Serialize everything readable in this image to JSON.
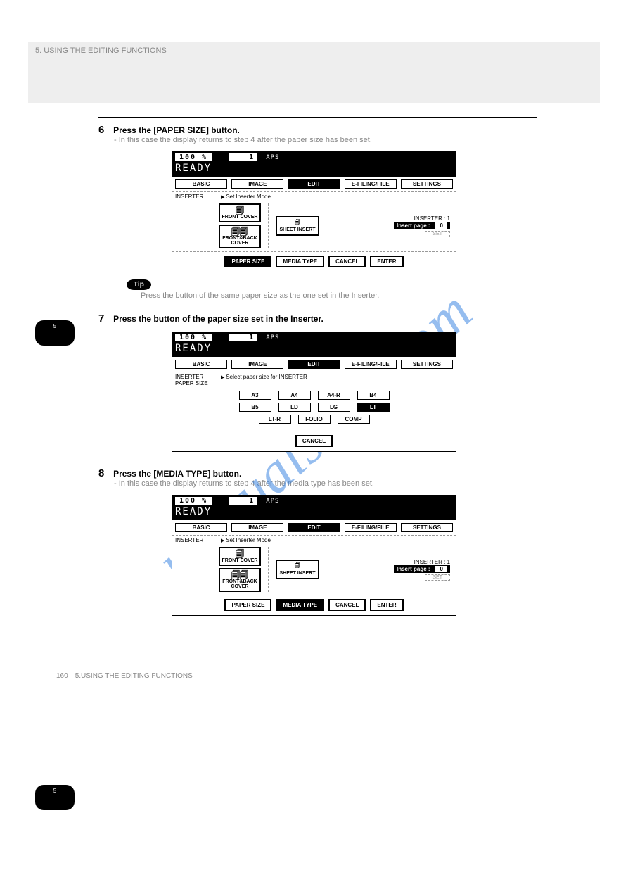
{
  "watermark": "manualslive.com",
  "greybar_text": "5. USING THE EDITING FUNCTIONS",
  "step6": {
    "num": "6",
    "text": "Press the [PAPER SIZE] button.",
    "sub": "- In this case the display returns to step 4 after the paper size has been set."
  },
  "panelA": {
    "percent": "100  %",
    "count": "1",
    "aps": "APS",
    "ready": "READY",
    "tabs": [
      "BASIC",
      "IMAGE",
      "EDIT",
      "E-FILING/FILE",
      "SETTINGS"
    ],
    "tabSel": 2,
    "leftLabel": "INSERTER",
    "hint": "Set Inserter Mode",
    "chips": [
      "FRONT COVER",
      "FRONT&BACK COVER"
    ],
    "sheetChip": "SHEET INSERT",
    "info1": "INSERTER    :    1",
    "insertLabel": "Insert page   :",
    "insertVal": "0",
    "setLabel": "SET",
    "foot": [
      "PAPER SIZE",
      "MEDIA TYPE",
      "CANCEL",
      "ENTER"
    ],
    "footSel": 0
  },
  "tip": {
    "pill": "Tip",
    "line": "Press the button of the same paper size as the one set in the Inserter."
  },
  "sideA": "5",
  "step7": {
    "num": "7",
    "text": "Press the button of the paper size set in the Inserter."
  },
  "panelB": {
    "percent": "100  %",
    "count": "1",
    "aps": "APS",
    "ready": "READY",
    "tabs": [
      "BASIC",
      "IMAGE",
      "EDIT",
      "E-FILING/FILE",
      "SETTINGS"
    ],
    "tabSel": 2,
    "leftLabel": "INSERTER",
    "leftSub": "PAPER SIZE",
    "hint": "Select paper size for INSERTER",
    "rows": [
      [
        "A3",
        "A4",
        "A4-R",
        "B4"
      ],
      [
        "B5",
        "LD",
        "LG",
        "LT"
      ],
      [
        "LT-R",
        "FOLIO",
        "COMP"
      ]
    ],
    "selRow": 1,
    "selCol": 3,
    "cancel": "CANCEL"
  },
  "step8": {
    "num": "8",
    "text": "Press the [MEDIA TYPE] button.",
    "sub": "- In this case the display returns to step 4 after the media type has been set."
  },
  "panelC": {
    "percent": "100  %",
    "count": "1",
    "aps": "APS",
    "ready": "READY",
    "tabs": [
      "BASIC",
      "IMAGE",
      "EDIT",
      "E-FILING/FILE",
      "SETTINGS"
    ],
    "tabSel": 2,
    "leftLabel": "INSERTER",
    "hint": "Set Inserter Mode",
    "chips": [
      "FRONT COVER",
      "FRONT&BACK COVER"
    ],
    "sheetChip": "SHEET INSERT",
    "info1": "INSERTER    :    1",
    "insertLabel": "Insert page   :",
    "insertVal": "0",
    "setLabel": "SET",
    "foot": [
      "PAPER SIZE",
      "MEDIA TYPE",
      "CANCEL",
      "ENTER"
    ],
    "footSel": 1
  },
  "sideB": "5",
  "footer": {
    "pagenum": "160",
    "title": "5.USING THE EDITING FUNCTIONS"
  }
}
